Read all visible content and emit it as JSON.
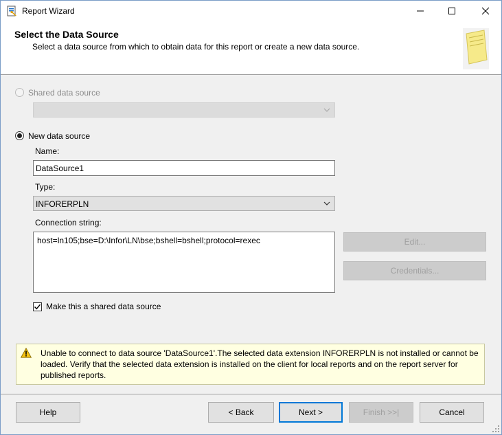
{
  "window": {
    "title": "Report Wizard",
    "controls": {
      "minimize": "—",
      "maximize": "☐",
      "close": "✕"
    }
  },
  "header": {
    "title": "Select the Data Source",
    "subtitle": "Select a data source from which to obtain data for this report or create a new data source."
  },
  "shared_source": {
    "label": "Shared data source",
    "selected": false,
    "enabled": false,
    "value": ""
  },
  "new_source": {
    "label": "New data source",
    "selected": true,
    "name_label": "Name:",
    "name_value": "DataSource1",
    "type_label": "Type:",
    "type_value": "INFORERPLN",
    "connection_label": "Connection string:",
    "connection_value": "host=ln105;bse=D:\\Infor\\LN\\bse;bshell=bshell;protocol=rexec",
    "edit_button": "Edit...",
    "credentials_button": "Credentials...",
    "shared_checkbox_label": "Make this a shared data source",
    "shared_checkbox_checked": true
  },
  "warning": {
    "icon": "warning-icon",
    "message": "Unable to connect to data source 'DataSource1'.The selected data extension INFORERPLN is not installed or cannot be loaded.  Verify that the selected data extension is installed on the client for local reports and on the report server for published reports."
  },
  "buttons": {
    "help": "Help",
    "back": "< Back",
    "next": "Next >",
    "finish": "Finish >>|",
    "cancel": "Cancel"
  },
  "colors": {
    "accent": "#0078d7",
    "warning_bg": "#ffffe1"
  }
}
